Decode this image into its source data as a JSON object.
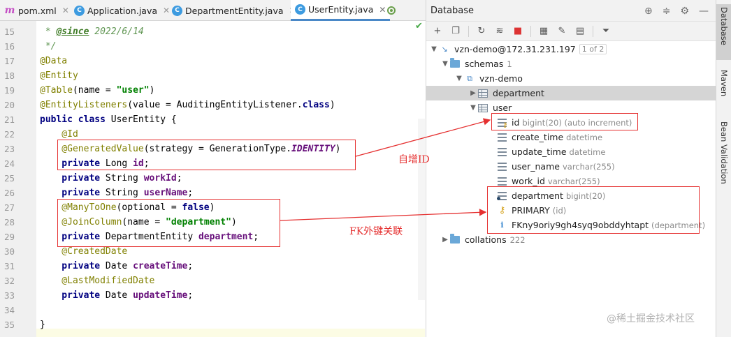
{
  "tabs": [
    {
      "label": "pom.xml",
      "icon": "maven-icon"
    },
    {
      "label": "Application.java",
      "icon": "spring-app-class-icon"
    },
    {
      "label": "DepartmentEntity.java",
      "icon": "java-class-icon"
    },
    {
      "label": "UserEntity.java",
      "icon": "java-class-icon",
      "active": true
    }
  ],
  "code": {
    "line_numbers": [
      "15",
      "16",
      "17",
      "18",
      "19",
      "20",
      "21",
      "22",
      "23",
      "24",
      "25",
      "26",
      "27",
      "28",
      "29",
      "30",
      "31",
      "32",
      "33",
      "34",
      "35"
    ],
    "lines": {
      "l15_a": " * ",
      "l15_tag": "@since",
      "l15_b": " 2022/6/14",
      "l16": " */",
      "l17": "@Data",
      "l18": "@Entity",
      "l19_a": "@Table",
      "l19_b": "(name = ",
      "l19_c": "\"user\"",
      "l19_d": ")",
      "l20_a": "@EntityListeners",
      "l20_b": "(value = AuditingEntityListener.",
      "l20_c": "class",
      "l20_d": ")",
      "l21_a": "public class",
      "l21_b": " UserEntity {",
      "l22": "    @Id",
      "l23_a": "    @GeneratedValue",
      "l23_b": "(strategy = GenerationType.",
      "l23_c": "IDENTITY",
      "l23_d": ")",
      "l24_a": "    private",
      "l24_b": " Long ",
      "l24_c": "id",
      "l24_d": ";",
      "l25_a": "    private",
      "l25_b": " String ",
      "l25_c": "workId",
      "l25_d": ";",
      "l26_a": "    private",
      "l26_b": " String ",
      "l26_c": "userName",
      "l26_d": ";",
      "l27_a": "    @ManyToOne",
      "l27_b": "(optional = ",
      "l27_c": "false",
      "l27_d": ")",
      "l28_a": "    @JoinColumn",
      "l28_b": "(name = ",
      "l28_c": "\"department\"",
      "l28_d": ")",
      "l29_a": "    private",
      "l29_b": " DepartmentEntity ",
      "l29_c": "department",
      "l29_d": ";",
      "l30": "    @CreatedDate",
      "l31_a": "    private",
      "l31_b": " Date ",
      "l31_c": "createTime",
      "l31_d": ";",
      "l32": "    @LastModifiedDate",
      "l33_a": "    private",
      "l33_b": " Date ",
      "l33_c": "updateTime",
      "l33_d": ";",
      "l35": "}"
    }
  },
  "database": {
    "title": "Database",
    "connection": {
      "name": "vzn-demo@172.31.231.197",
      "badge": "1 of 2"
    },
    "schemas": {
      "label": "schemas",
      "count": "1"
    },
    "schema": "vzn-demo",
    "tables": {
      "department": "department",
      "user": "user"
    },
    "columns": [
      {
        "name": "id",
        "type": "bigint(20) (auto increment)"
      },
      {
        "name": "create_time",
        "type": "datetime"
      },
      {
        "name": "update_time",
        "type": "datetime"
      },
      {
        "name": "user_name",
        "type": "varchar(255)"
      },
      {
        "name": "work_id",
        "type": "varchar(255)"
      },
      {
        "name": "department",
        "type": "bigint(20)"
      }
    ],
    "key": {
      "name": "PRIMARY",
      "type": "(id)"
    },
    "index": {
      "name": "FKny9oriy9gh4syq9obddyhtapt",
      "type": "(department)"
    },
    "collations": {
      "label": "collations",
      "count": "222"
    }
  },
  "side_tabs": [
    "Database",
    "Maven",
    "Bean Validation"
  ],
  "annotations": {
    "auto_id": "自增ID",
    "fk": "FK外键关联"
  },
  "watermark": "@稀土掘金技术社区",
  "colors": {
    "accent": "#4a88c7",
    "annotation": "#e53030",
    "annotation_box": "#e53030"
  }
}
